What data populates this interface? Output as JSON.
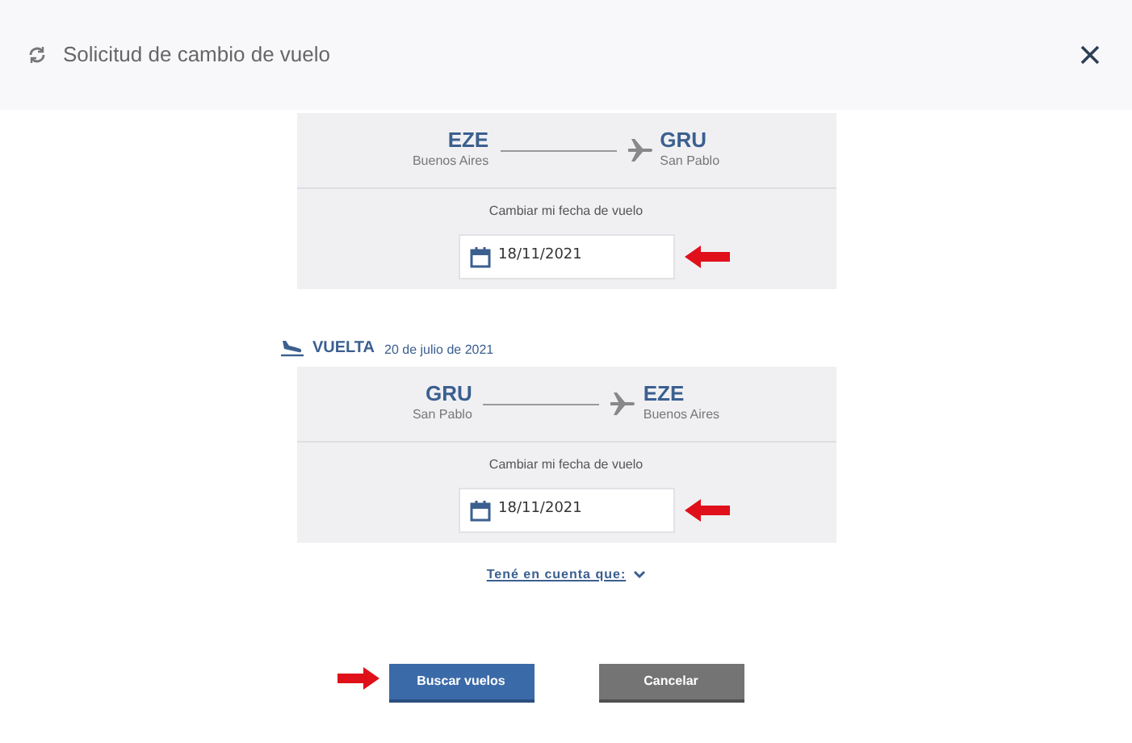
{
  "dialog": {
    "title": "Solicitud de cambio de vuelo"
  },
  "legs": [
    {
      "origin": {
        "code": "EZE",
        "city": "Buenos Aires"
      },
      "destination": {
        "code": "GRU",
        "city": "San Pablo"
      },
      "change_label": "Cambiar mi fecha de vuelo",
      "date": "18/11/2021"
    },
    {
      "header": {
        "label": "VUELTA",
        "date": "20 de julio de 2021"
      },
      "origin": {
        "code": "GRU",
        "city": "San Pablo"
      },
      "destination": {
        "code": "EZE",
        "city": "Buenos Aires"
      },
      "change_label": "Cambiar mi fecha de vuelo",
      "date": "18/11/2021"
    }
  ],
  "note_link": {
    "label": "Tené en cuenta que:",
    "expanded": false
  },
  "buttons": [
    {
      "label": "Buscar vuelos",
      "kind": "primary"
    },
    {
      "label": "Cancelar",
      "kind": "secondary"
    }
  ]
}
